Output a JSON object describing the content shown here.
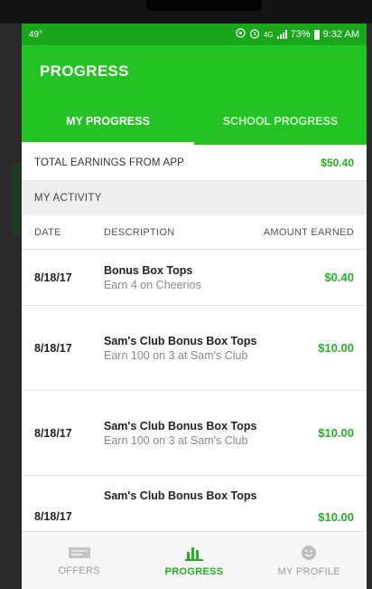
{
  "status_bar": {
    "temperature": "49°",
    "network": "4G",
    "battery_percent": "73%",
    "time": "9:32 AM"
  },
  "app_bar": {
    "title": "PROGRESS"
  },
  "tabs": [
    {
      "label": "MY PROGRESS",
      "active": true
    },
    {
      "label": "SCHOOL PROGRESS",
      "active": false
    }
  ],
  "earnings": {
    "label": "TOTAL EARNINGS FROM APP",
    "value": "$50.40"
  },
  "activity": {
    "header": "MY ACTIVITY",
    "columns": {
      "date": "DATE",
      "description": "DESCRIPTION",
      "amount": "AMOUNT EARNED"
    },
    "rows": [
      {
        "date": "8/18/17",
        "title": "Bonus Box Tops",
        "subtitle": "Earn 4 on Cheerios",
        "amount": "$0.40"
      },
      {
        "date": "8/18/17",
        "title": "Sam's Club Bonus Box Tops",
        "subtitle": "Earn 100 on 3 at Sam's Club",
        "amount": "$10.00"
      },
      {
        "date": "8/18/17",
        "title": "Sam's Club Bonus Box Tops",
        "subtitle": "Earn 100 on 3 at Sam's Club",
        "amount": "$10.00"
      },
      {
        "date": "8/18/17",
        "title": "Sam's Club Bonus Box Tops",
        "subtitle": "",
        "amount": "$10.00"
      }
    ]
  },
  "bottom_nav": [
    {
      "label": "OFFERS",
      "icon": "offers-icon",
      "active": false
    },
    {
      "label": "PROGRESS",
      "icon": "bar-chart-icon",
      "active": true
    },
    {
      "label": "MY PROFILE",
      "icon": "smiley-icon",
      "active": false
    }
  ],
  "colors": {
    "brand_green": "#22c322",
    "status_green": "#1aa61a",
    "amount_green": "#22b022"
  }
}
